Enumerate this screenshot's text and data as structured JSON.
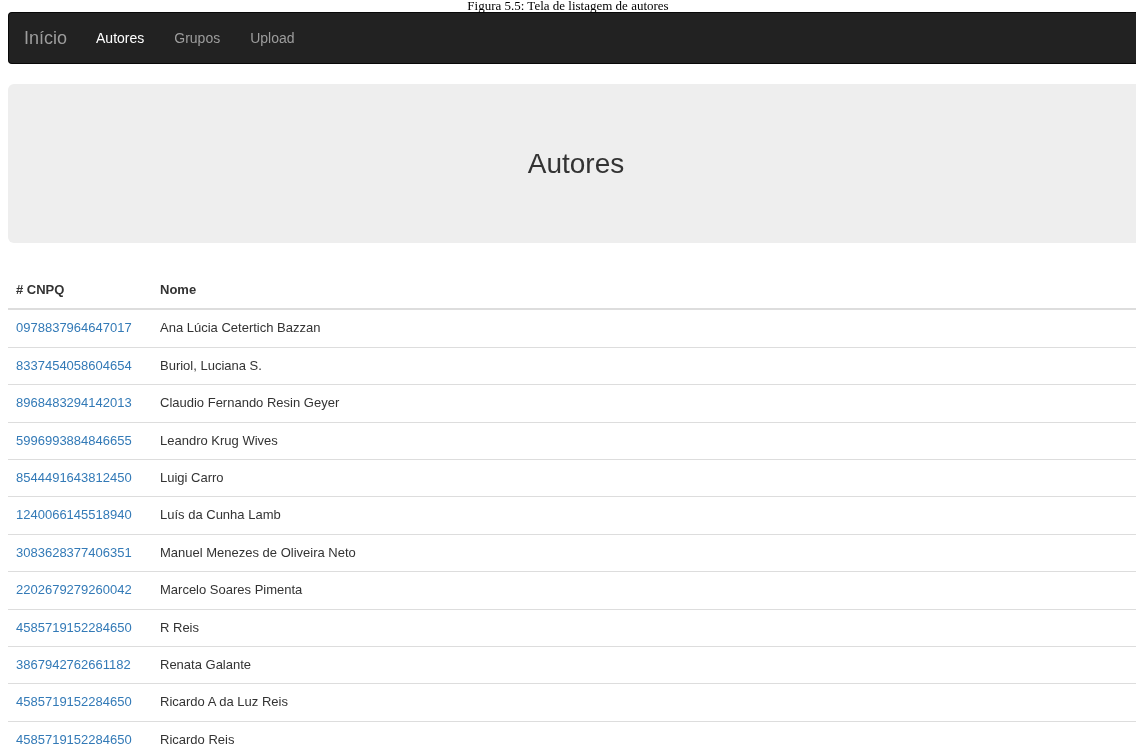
{
  "caption": "Figura 5.5: Tela de listagem de autores",
  "navbar": {
    "brand": "Início",
    "links": [
      {
        "label": "Autores",
        "selected": true
      },
      {
        "label": "Grupos",
        "selected": false
      },
      {
        "label": "Upload",
        "selected": false
      }
    ]
  },
  "jumbotron": {
    "title": "Autores"
  },
  "table": {
    "columns": [
      "# CNPQ",
      "Nome"
    ],
    "rows": [
      {
        "cnpq": "0978837964647017",
        "nome": "Ana Lúcia Cetertich Bazzan"
      },
      {
        "cnpq": "8337454058604654",
        "nome": "Buriol, Luciana S."
      },
      {
        "cnpq": "8968483294142013",
        "nome": "Claudio Fernando Resin Geyer"
      },
      {
        "cnpq": "5996993884846655",
        "nome": "Leandro Krug Wives"
      },
      {
        "cnpq": "8544491643812450",
        "nome": "Luigi Carro"
      },
      {
        "cnpq": "1240066145518940",
        "nome": "Luís da Cunha Lamb"
      },
      {
        "cnpq": "3083628377406351",
        "nome": "Manuel Menezes de Oliveira Neto"
      },
      {
        "cnpq": "2202679279260042",
        "nome": "Marcelo Soares Pimenta"
      },
      {
        "cnpq": "4585719152284650",
        "nome": "R Reis"
      },
      {
        "cnpq": "3867942762661182",
        "nome": "Renata Galante"
      },
      {
        "cnpq": "4585719152284650",
        "nome": "Ricardo A da Luz Reis"
      },
      {
        "cnpq": "4585719152284650",
        "nome": "Ricardo Reis"
      }
    ]
  }
}
